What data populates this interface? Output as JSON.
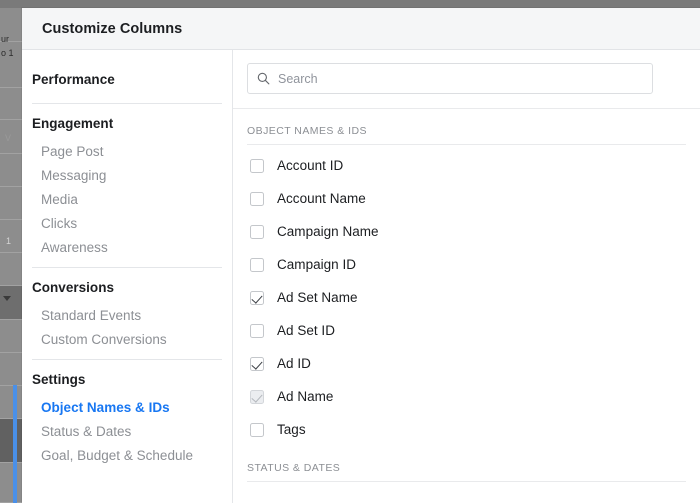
{
  "background": {
    "fragment_texts": [
      "ur",
      "o 1",
      "V",
      "1"
    ]
  },
  "modal": {
    "title": "Customize Columns"
  },
  "sidebar": {
    "groups": [
      {
        "title": "Performance",
        "items": [],
        "divider_after": true
      },
      {
        "title": "Engagement",
        "items": [
          {
            "label": "Page Post",
            "active": false
          },
          {
            "label": "Messaging",
            "active": false
          },
          {
            "label": "Media",
            "active": false
          },
          {
            "label": "Clicks",
            "active": false
          },
          {
            "label": "Awareness",
            "active": false
          }
        ],
        "divider_after": true
      },
      {
        "title": "Conversions",
        "items": [
          {
            "label": "Standard Events",
            "active": false
          },
          {
            "label": "Custom Conversions",
            "active": false
          }
        ],
        "divider_after": true
      },
      {
        "title": "Settings",
        "items": [
          {
            "label": "Object Names & IDs",
            "active": true
          },
          {
            "label": "Status & Dates",
            "active": false
          },
          {
            "label": "Goal, Budget & Schedule",
            "active": false
          }
        ],
        "divider_after": false
      }
    ]
  },
  "search": {
    "placeholder": "Search",
    "value": "",
    "icon": "search-icon"
  },
  "sections": [
    {
      "header": "OBJECT NAMES & IDS",
      "options": [
        {
          "label": "Account ID",
          "checked": false,
          "disabled": false
        },
        {
          "label": "Account Name",
          "checked": false,
          "disabled": false
        },
        {
          "label": "Campaign Name",
          "checked": false,
          "disabled": false
        },
        {
          "label": "Campaign ID",
          "checked": false,
          "disabled": false
        },
        {
          "label": "Ad Set Name",
          "checked": true,
          "disabled": false
        },
        {
          "label": "Ad Set ID",
          "checked": false,
          "disabled": false
        },
        {
          "label": "Ad ID",
          "checked": true,
          "disabled": false
        },
        {
          "label": "Ad Name",
          "checked": true,
          "disabled": true
        },
        {
          "label": "Tags",
          "checked": false,
          "disabled": false
        }
      ]
    },
    {
      "header": "STATUS & DATES",
      "options": []
    }
  ],
  "colors": {
    "accent": "#1877f2",
    "header_bg": "#f5f6f7",
    "text": "#1c1e21",
    "muted": "#8c8f94",
    "border": "#e4e6e9"
  }
}
